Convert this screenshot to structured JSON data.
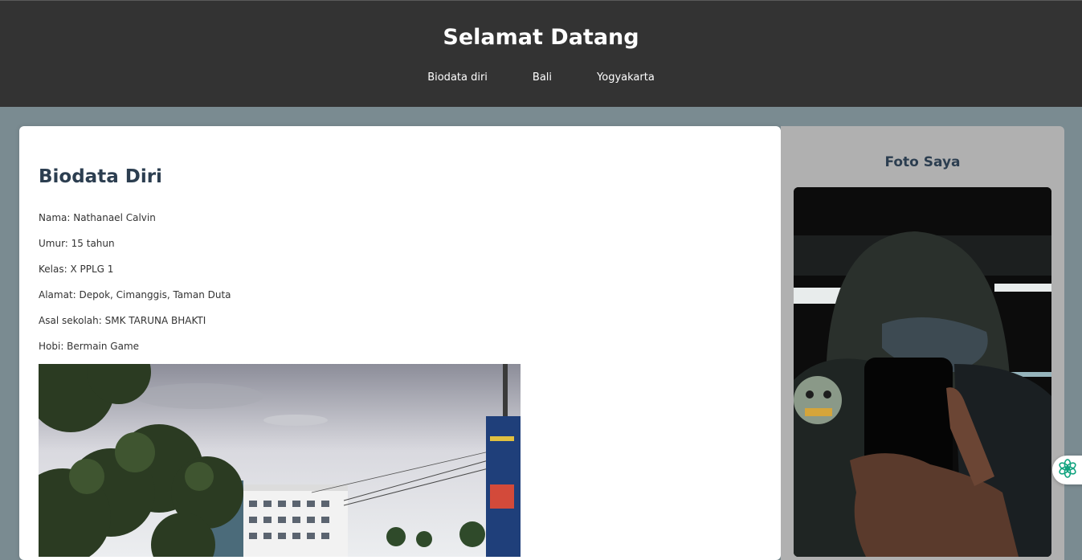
{
  "header": {
    "title": "Selamat Datang",
    "nav": [
      "Biodata diri",
      "Bali",
      "Yogyakarta"
    ]
  },
  "main": {
    "heading": "Biodata Diri",
    "info": [
      "Nama: Nathanael Calvin",
      "Umur: 15 tahun",
      "Kelas: X PPLG 1",
      "Alamat: Depok, Cimanggis, Taman Duta",
      "Asal sekolah: SMK TARUNA BHAKTI",
      "Hobi: Bermain Game"
    ]
  },
  "sidebar": {
    "heading": "Foto Saya"
  },
  "icons": {
    "assistant": "openai-flower-icon"
  },
  "colors": {
    "header_bg": "#333333",
    "page_bg": "#7a8b91",
    "heading": "#2c3e50",
    "sidebar_bg": "#b0b0b0",
    "assistant_accent": "#10a37f"
  }
}
